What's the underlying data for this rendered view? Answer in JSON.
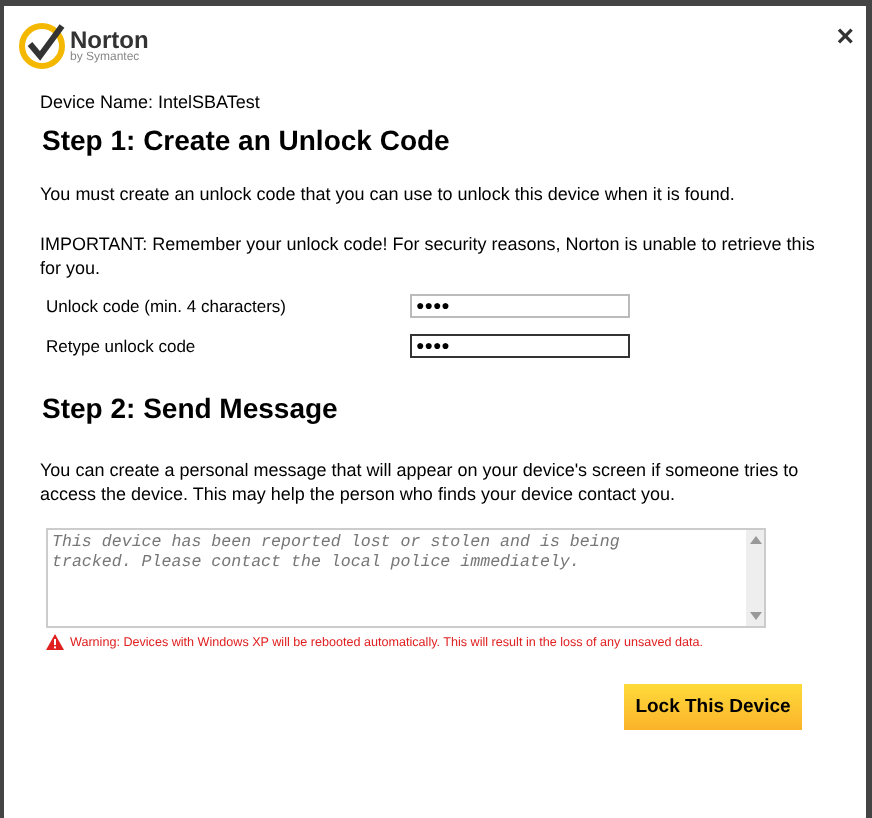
{
  "logo": {
    "name": "Norton",
    "tagline": "by Symantec"
  },
  "close": "×",
  "device_name": "Device Name: IntelSBATest",
  "step1": {
    "heading": "Step 1: Create an Unlock Code",
    "intro": "You must create an unlock code that you can use to unlock this device when it is found.",
    "important": "IMPORTANT: Remember your unlock code! For security reasons, Norton is unable to retrieve this for you.",
    "fields": [
      {
        "label": "Unlock code (min. 4 characters)",
        "value": "●●●●",
        "focused": false
      },
      {
        "label": "Retype unlock code",
        "value": "●●●●",
        "focused": true
      }
    ]
  },
  "step2": {
    "heading": "Step 2: Send Message",
    "intro": "You can create a personal message that will appear on your device's screen if someone tries to access the device. This may help the person who finds your device contact you.",
    "message": {
      "placeholder": "This device has been reported lost or stolen and is being tracked. Please contact the local police immediately."
    },
    "warning": "Warning: Devices with Windows XP will be rebooted automatically. This will result in the loss of any unsaved data."
  },
  "buttons": [
    "Lock This Device"
  ]
}
